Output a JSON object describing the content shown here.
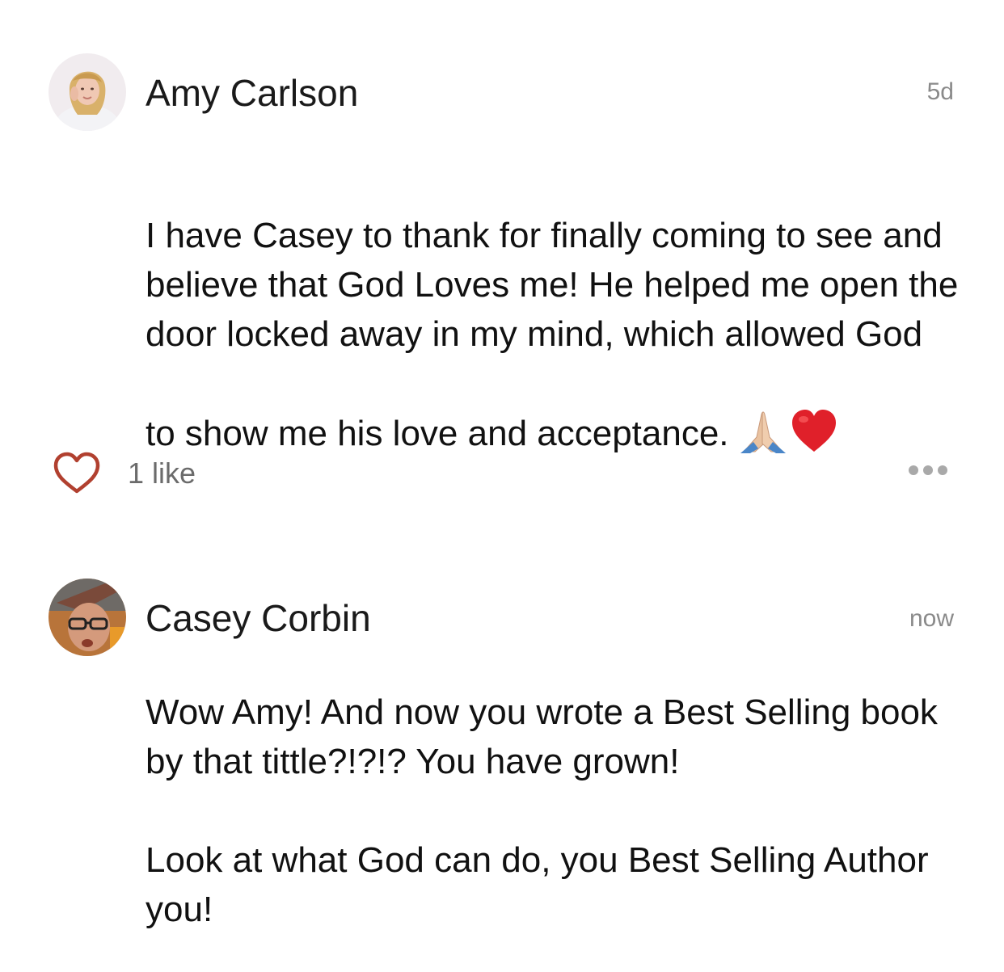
{
  "comments": [
    {
      "author": "Amy Carlson",
      "time": "5d",
      "text": "I have Casey to thank for finally coming to see and believe that God Loves me! He helped me open the door locked away in my mind, which allowed God to show me his love and acceptance.",
      "emojis": [
        "🙏🏼",
        "❤️"
      ],
      "likes_label": "1 like",
      "avatar_icon": "user-avatar-photo"
    },
    {
      "author": "Casey Corbin",
      "time": "now",
      "text": "Wow Amy!  And now you wrote a Best Selling book by that tittle?!?!?  You have grown!\n\nLook at what God can do, you Best Selling Author you!",
      "avatar_icon": "user-avatar-photo"
    }
  ],
  "icons": {
    "like": "heart-outline-icon",
    "more": "more-options-icon"
  },
  "colors": {
    "heart": "#b1402f",
    "muted": "#8a8a8a",
    "text": "#111111"
  }
}
